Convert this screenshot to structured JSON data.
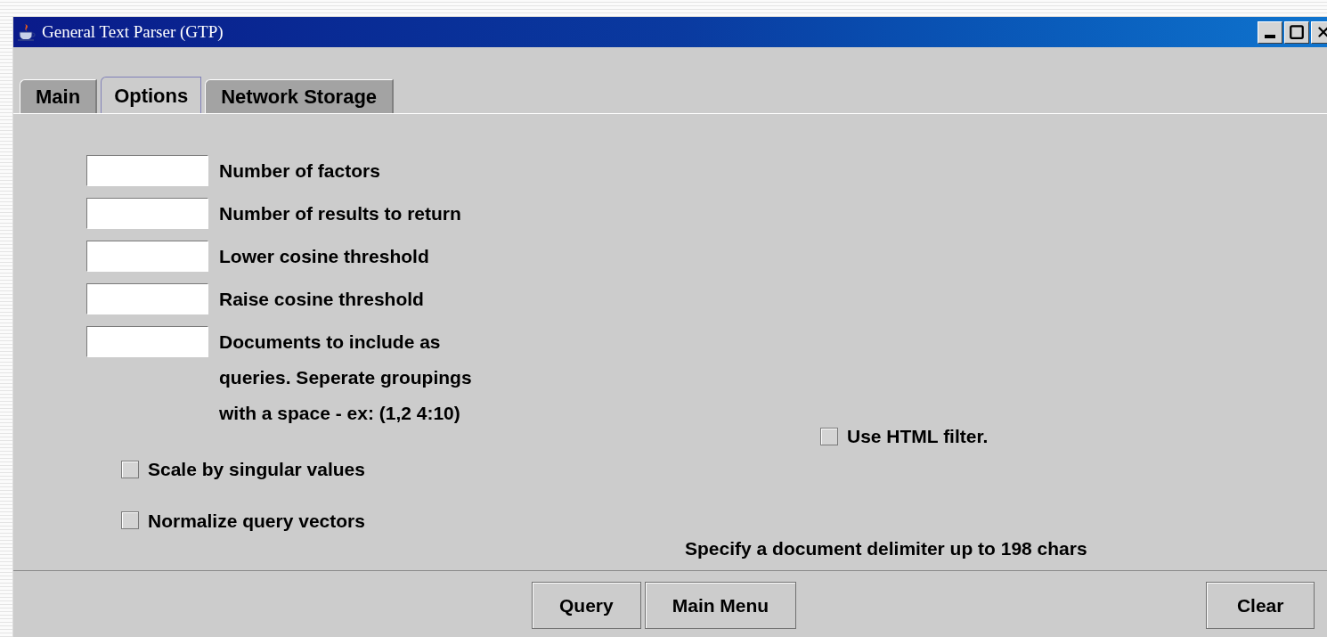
{
  "window": {
    "title": "General Text Parser (GTP)"
  },
  "tabs": [
    {
      "label": "Main",
      "selected": false
    },
    {
      "label": "Options",
      "selected": true
    },
    {
      "label": "Network Storage",
      "selected": false
    }
  ],
  "fields": [
    {
      "label": "Number of factors"
    },
    {
      "label": "Number of results to return"
    },
    {
      "label": "Lower cosine threshold"
    },
    {
      "label": "Raise cosine threshold"
    },
    {
      "label": "Documents to include as queries. Seperate groupings with a space - ex: (1,2 4:10)"
    }
  ],
  "checkboxes": [
    {
      "label": "Scale by singular values",
      "checked": false
    },
    {
      "label": "Normalize query vectors",
      "checked": false
    }
  ],
  "html_filter": {
    "label": "Use HTML filter.",
    "checked": false
  },
  "delimiter_note": "Specify a document delimiter up to 198 chars",
  "buttons": [
    "Query",
    "Main Menu"
  ],
  "clear_button": "Clear"
}
